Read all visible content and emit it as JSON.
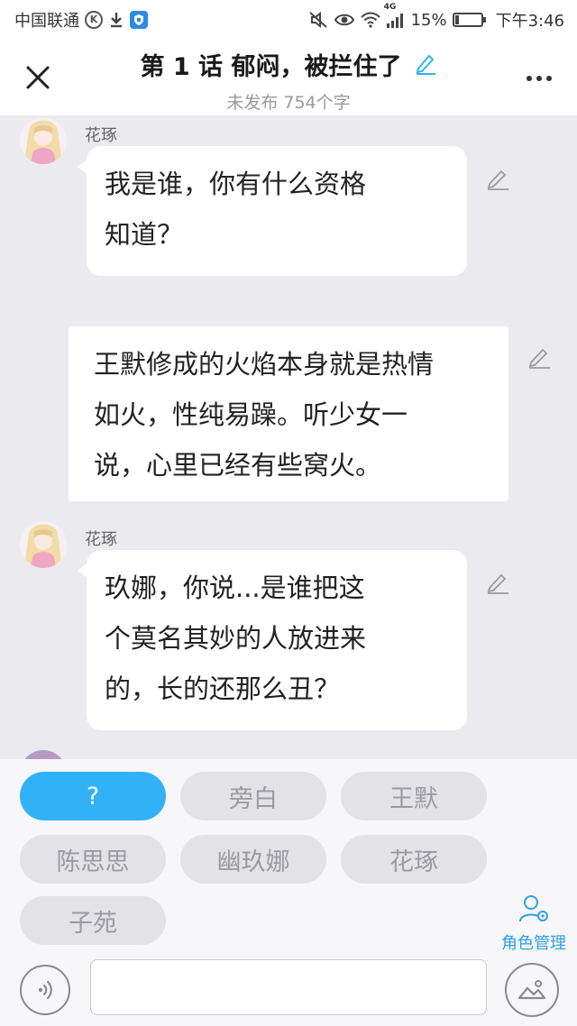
{
  "status_bar": {
    "carrier": "中国联通",
    "battery_percent_text": "15%",
    "battery_level": 0.15,
    "time": "下午3:46",
    "network": "4G",
    "icons": [
      "k-badge-icon",
      "download-icon",
      "shield-app-icon",
      "mute-icon",
      "eye-icon",
      "wifi-icon",
      "signal-icon",
      "battery-icon"
    ]
  },
  "header": {
    "title": "第 1 话 郁闷，被拦住了",
    "subtitle": "未发布 754个字",
    "icons": [
      "close-icon",
      "pencil-icon",
      "more-icon"
    ]
  },
  "messages": [
    {
      "type": "character",
      "speaker": "花琢",
      "lines": [
        "我是谁，你有什么资格",
        "知道？"
      ]
    },
    {
      "type": "narration",
      "lines": [
        "王默修成的火焰本身就是热情",
        "如火，性纯易躁。听少女一",
        "说，心里已经有些窝火。"
      ]
    },
    {
      "type": "character",
      "speaker": "花琢",
      "lines": [
        "玖娜，你说...是谁把这",
        "个莫名其妙的人放进来",
        "的，长的还那么丑？"
      ]
    }
  ],
  "roles": {
    "chips": [
      "?",
      "旁白",
      "王默",
      "陈思思",
      "幽玖娜",
      "花琢",
      "子苑"
    ],
    "selected": "?",
    "manage_label": "角色管理"
  },
  "input": {
    "value": "",
    "placeholder": ""
  },
  "colors": {
    "accent": "#31b2f8",
    "chat_background": "#ebebef",
    "link_blue": "#2f9ee6"
  }
}
